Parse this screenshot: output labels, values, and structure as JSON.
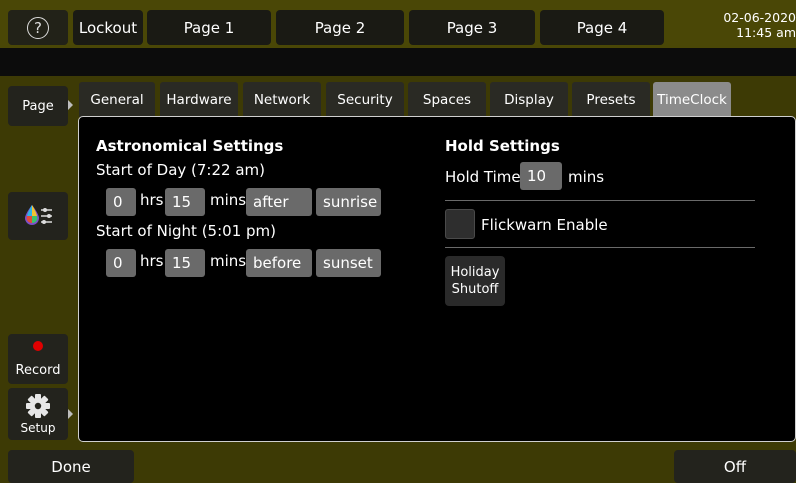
{
  "header": {
    "help_glyph": "?",
    "buttons": [
      "Lockout",
      "Page 1",
      "Page 2",
      "Page 3",
      "Page 4"
    ],
    "date": "02-06-2020",
    "time": "11:45 am"
  },
  "sidebar": {
    "page_label": "Page",
    "record_label": "Record",
    "setup_label": "Setup"
  },
  "tabs": [
    "General",
    "Hardware",
    "Network",
    "Security",
    "Spaces",
    "Display",
    "Presets",
    "TimeClock"
  ],
  "active_tab": "TimeClock",
  "astronomical": {
    "title": "Astronomical Settings",
    "start_of_day_label": "Start of Day (7:22 am)",
    "day_hrs": "0",
    "day_mins": "15",
    "day_when": "after",
    "day_event": "sunrise",
    "start_of_night_label": "Start of Night (5:01 pm)",
    "night_hrs": "0",
    "night_mins": "15",
    "night_when": "before",
    "night_event": "sunset",
    "hrs_unit": "hrs",
    "mins_unit": "mins"
  },
  "hold": {
    "title": "Hold Settings",
    "hold_time_label": "Hold Time",
    "hold_time_value": "10",
    "mins_unit": "mins",
    "flickwarn_label": "Flickwarn Enable",
    "holiday_line1": "Holiday",
    "holiday_line2": "Shutoff"
  },
  "footer": {
    "done_label": "Done",
    "off_label": "Off"
  },
  "colors": {
    "olive": "#3d3a05",
    "record_dot": "#e00000",
    "active_tab": "#8b8b8b"
  }
}
